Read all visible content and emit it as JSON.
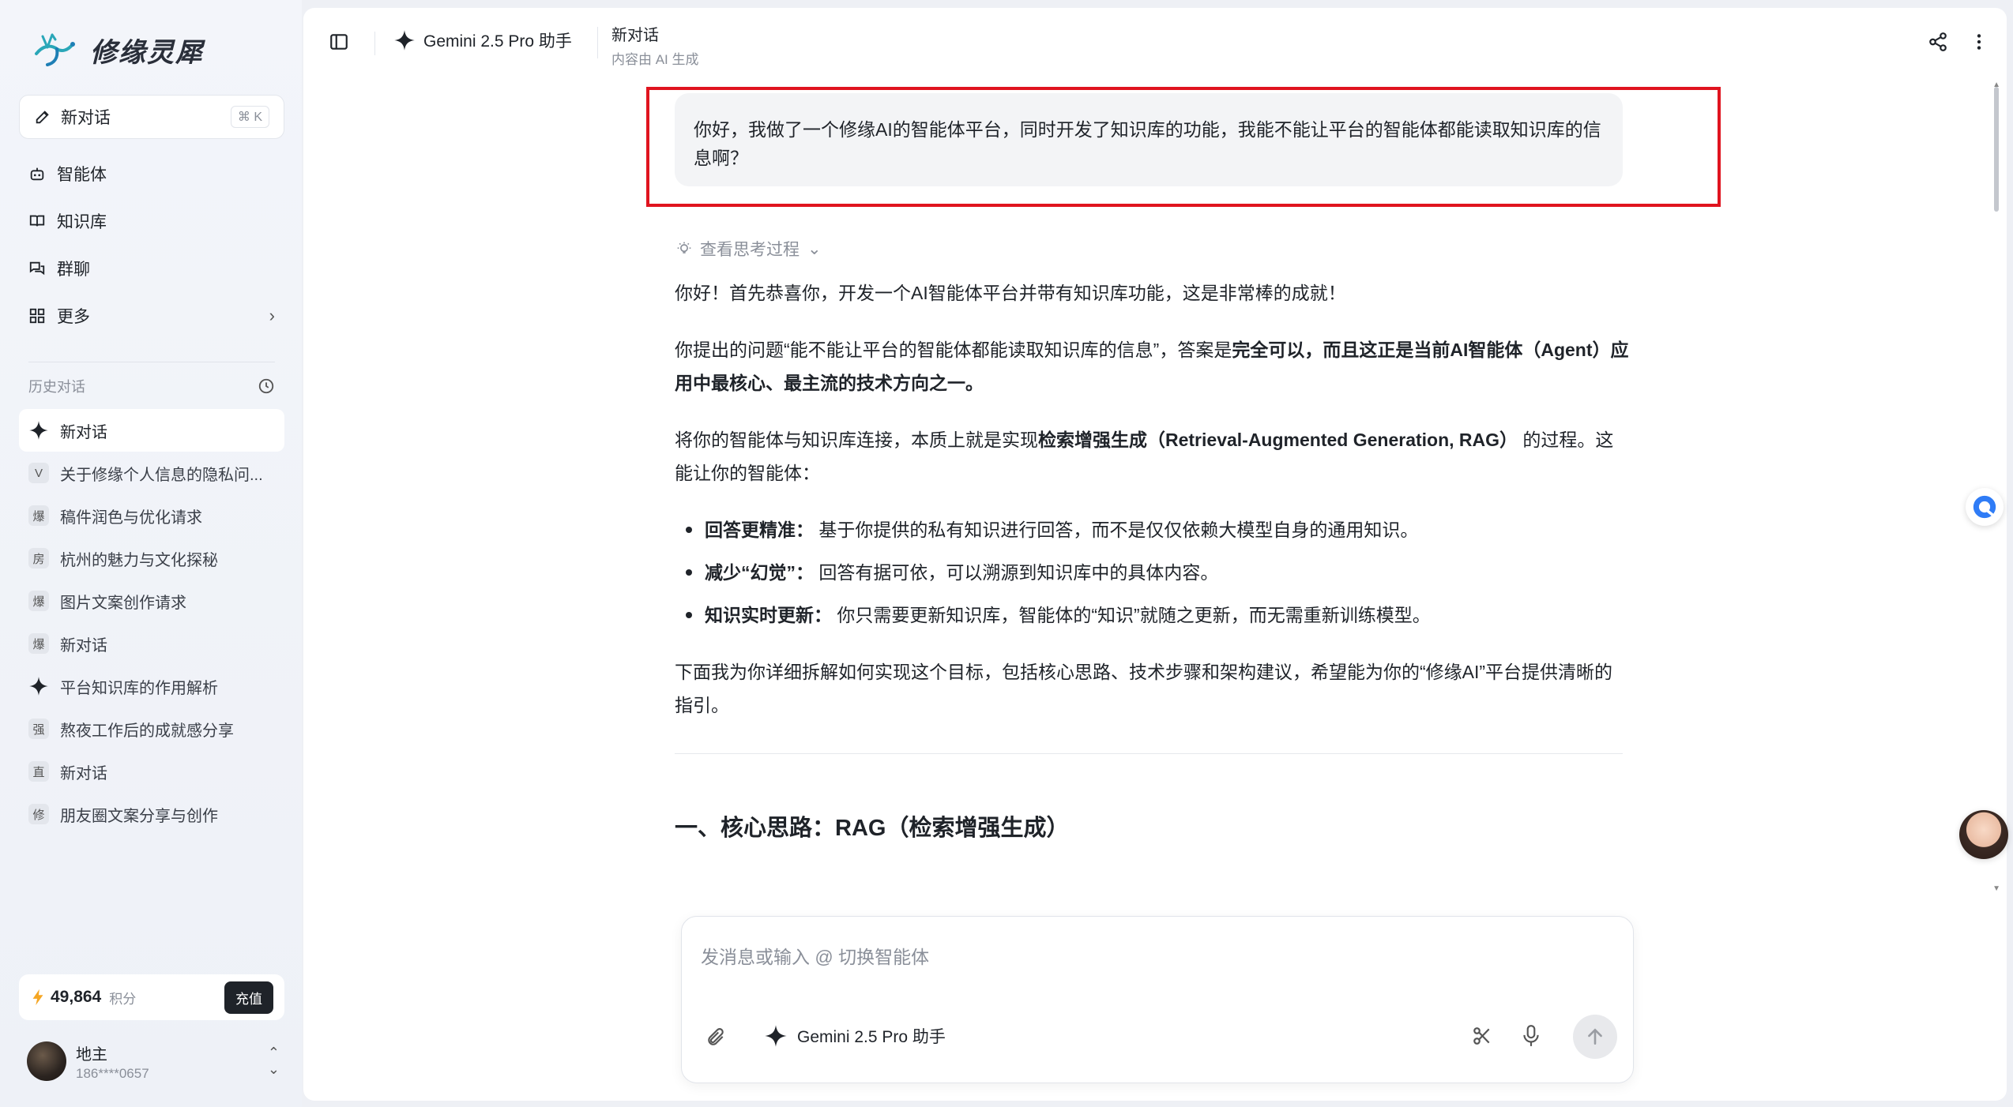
{
  "brand": {
    "name": "修缘灵犀"
  },
  "sidebar": {
    "new_chat": {
      "label": "新对话",
      "shortcut": "⌘ K"
    },
    "nav": [
      {
        "label": "智能体",
        "icon": "robot-icon"
      },
      {
        "label": "知识库",
        "icon": "book-icon"
      },
      {
        "label": "群聊",
        "icon": "chat-icon"
      },
      {
        "label": "更多",
        "icon": "grid-icon"
      }
    ],
    "history_title": "历史对话",
    "history": [
      {
        "badge": "",
        "label": "新对话",
        "star": true,
        "active": true
      },
      {
        "badge": "V",
        "label": "关于修缘个人信息的隐私问..."
      },
      {
        "badge": "爆",
        "label": "稿件润色与优化请求"
      },
      {
        "badge": "房",
        "label": "杭州的魅力与文化探秘"
      },
      {
        "badge": "爆",
        "label": "图片文案创作请求"
      },
      {
        "badge": "爆",
        "label": "新对话"
      },
      {
        "badge": "",
        "label": "平台知识库的作用解析",
        "star": true
      },
      {
        "badge": "强",
        "label": "熬夜工作后的成就感分享"
      },
      {
        "badge": "直",
        "label": "新对话"
      },
      {
        "badge": "修",
        "label": "朋友圈文案分享与创作"
      }
    ],
    "credits": {
      "value": "49,864",
      "unit": "积分",
      "recharge": "充值"
    },
    "user": {
      "name": "地主",
      "phone": "186****0657"
    }
  },
  "topbar": {
    "model": "Gemini 2.5 Pro 助手",
    "title": "新对话",
    "subtitle": "内容由 AI 生成"
  },
  "conversation": {
    "user_message": "你好，我做了一个修缘AI的智能体平台，同时开发了知识库的功能，我能不能让平台的智能体都能读取知识库的信息啊？",
    "think_label": "查看思考过程",
    "p1": "你好！首先恭喜你，开发一个AI智能体平台并带有知识库功能，这是非常棒的成就！",
    "p2_a": "你提出的问题“能不能让平台的智能体都能读取知识库的信息”，答案是",
    "p2_b": "完全可以，而且这正是当前AI智能体（Agent）应用中最核心、最主流的技术方向之一。",
    "p3_a": "将你的智能体与知识库连接，本质上就是实现",
    "p3_b": "检索增强生成（Retrieval-Augmented Generation, RAG）",
    "p3_c": " 的过程。这能让你的智能体：",
    "bullets": [
      {
        "title": "回答更精准：",
        "text": " 基于你提供的私有知识进行回答，而不是仅仅依赖大模型自身的通用知识。"
      },
      {
        "title": "减少“幻觉”：",
        "text": " 回答有据可依，可以溯源到知识库中的具体内容。"
      },
      {
        "title": "知识实时更新：",
        "text": " 你只需要更新知识库，智能体的“知识”就随之更新，而无需重新训练模型。"
      }
    ],
    "p4": "下面我为你详细拆解如何实现这个目标，包括核心思路、技术步骤和架构建议，希望能为你的“修缘AI”平台提供清晰的指引。",
    "h2": "一、核心思路：RAG（检索增强生成）"
  },
  "composer": {
    "placeholder": "发消息或输入 @ 切换智能体",
    "model": "Gemini 2.5 Pro 助手"
  },
  "colors": {
    "highlight_frame": "#e0141f",
    "accent": "#1f2329"
  }
}
